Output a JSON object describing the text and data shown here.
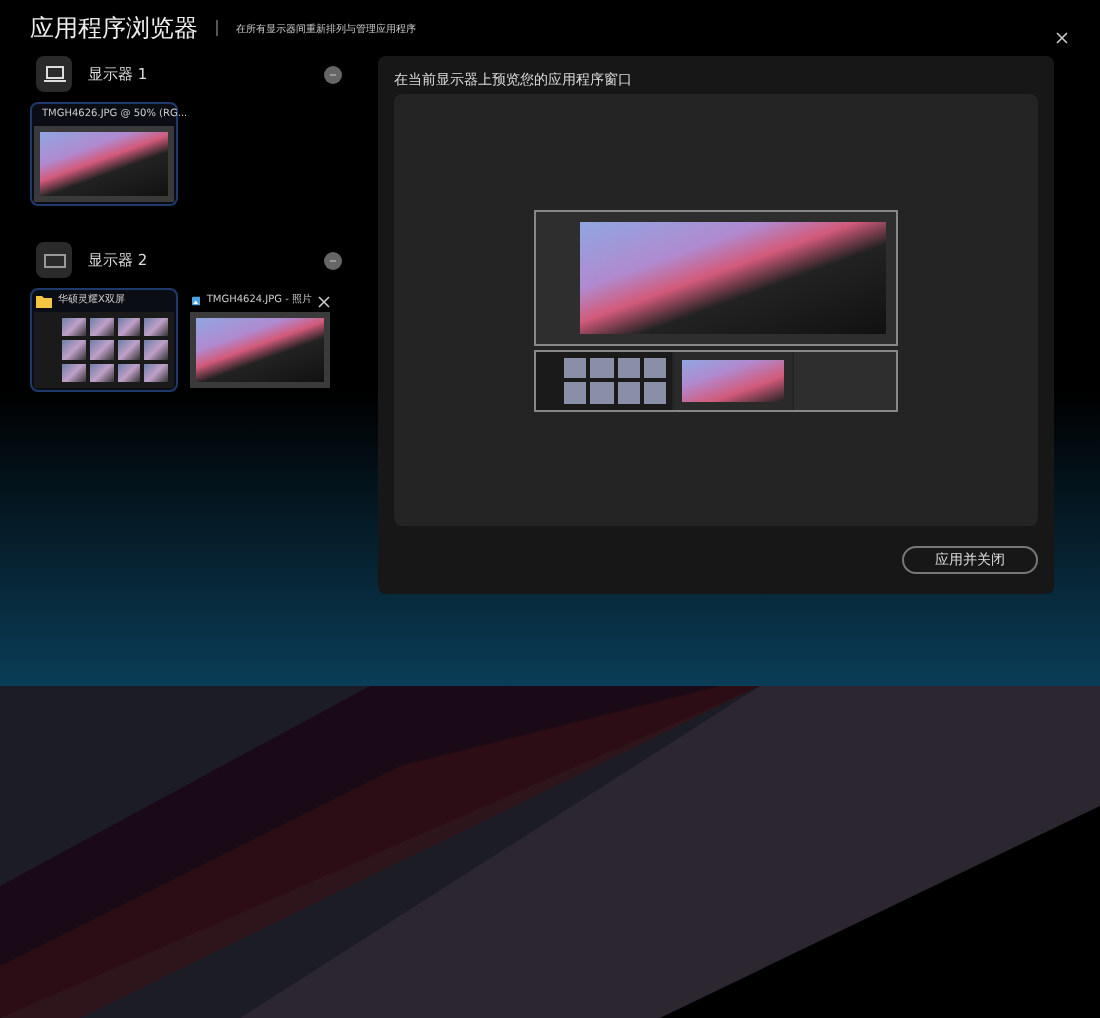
{
  "window": {
    "title": "应用程序浏览器",
    "subtitle": "在所有显示器间重新排列与管理应用程序"
  },
  "displays": [
    {
      "name": "显示器 1",
      "kind": "laptop",
      "windows": [
        {
          "title": "TMGH4626.JPG @ 50% (RG...",
          "kind": "photoshop",
          "selected": true,
          "hovered": false
        }
      ]
    },
    {
      "name": "显示器 2",
      "kind": "screenpad",
      "windows": [
        {
          "title": "华硕灵耀X双屏",
          "kind": "folder",
          "selected": true,
          "hovered": false
        },
        {
          "title": "TMGH4624.JPG - 照片",
          "kind": "photos",
          "selected": false,
          "hovered": true
        }
      ]
    }
  ],
  "preview": {
    "title": "在当前显示器上预览您的应用程序窗口"
  },
  "apply_button": "应用并关闭"
}
